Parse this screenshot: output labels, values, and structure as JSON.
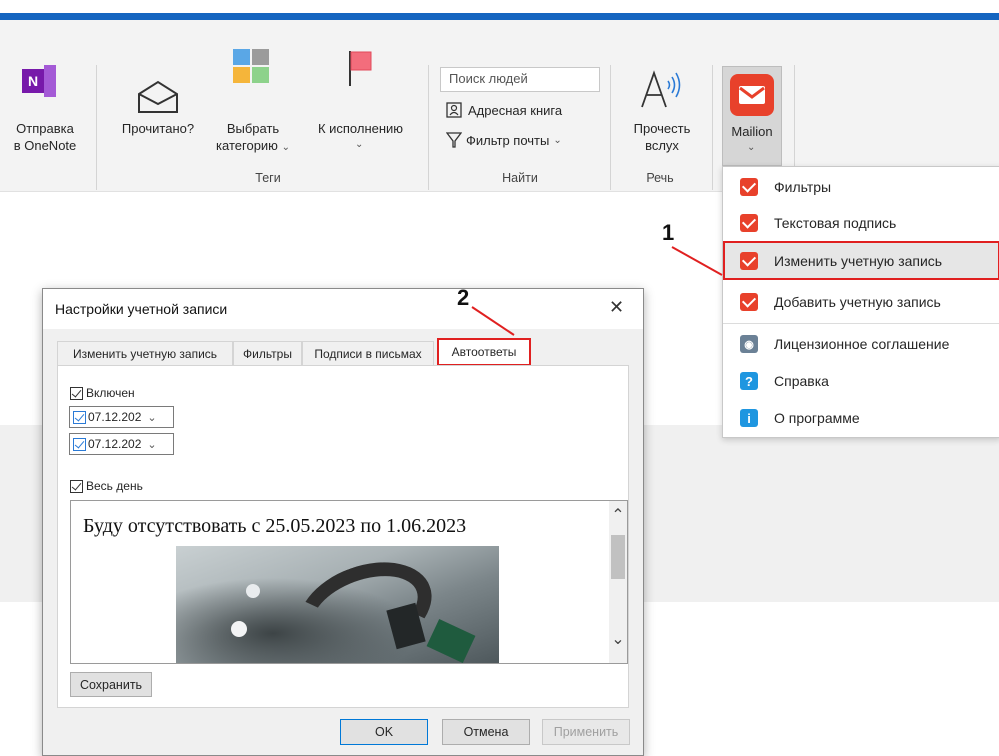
{
  "ribbon": {
    "onenote": {
      "line1": "Отправка",
      "line2": "в OneNote"
    },
    "read": {
      "label": "Прочитано?"
    },
    "categorize": {
      "line1": "Выбрать",
      "line2": "категорию"
    },
    "followup": {
      "label": "К исполнению"
    },
    "tags_group": "Теги",
    "search_people": {
      "placeholder": "Поиск людей"
    },
    "address_book": "Адресная книга",
    "filter_mail": "Фильтр почты",
    "find_group": "Найти",
    "read_aloud": {
      "line1": "Прочесть",
      "line2": "вслух"
    },
    "speech_group": "Речь",
    "mailion": {
      "label": "Mailion"
    }
  },
  "mailion_menu": {
    "items": [
      {
        "label": "Фильтры",
        "icon": "mailion-icon"
      },
      {
        "label": "Текстовая подпись",
        "icon": "mailion-icon"
      },
      {
        "label": "Изменить учетную запись",
        "icon": "mailion-icon",
        "highlighted": true
      },
      {
        "label": "Добавить учетную запись",
        "icon": "mailion-icon"
      },
      {
        "label": "Лицензионное соглашение",
        "icon": "lock-icon"
      },
      {
        "label": "Справка",
        "icon": "question-icon"
      },
      {
        "label": "О программе",
        "icon": "info-icon"
      }
    ]
  },
  "annotations": {
    "step1": "1",
    "step2": "2"
  },
  "dialog": {
    "title": "Настройки учетной записи",
    "close_glyph": "✕",
    "tabs": [
      {
        "label": "Изменить учетную запись"
      },
      {
        "label": "Фильтры"
      },
      {
        "label": "Подписи в письмах"
      },
      {
        "label": "Автоответы",
        "active": true
      }
    ],
    "enabled_label": "Включен",
    "date_from": "07.12.202",
    "date_to": "07.12.202",
    "all_day_label": "Весь день",
    "message_text": "Буду отсутствовать с 25.05.2023 по 1.06.2023",
    "save_label": "Сохранить",
    "ok_label": "OK",
    "cancel_label": "Отмена",
    "apply_label": "Применить"
  },
  "colors": {
    "accent_blue": "#1565c0",
    "mailion_red": "#e8412b",
    "highlight_red": "#e02020"
  }
}
